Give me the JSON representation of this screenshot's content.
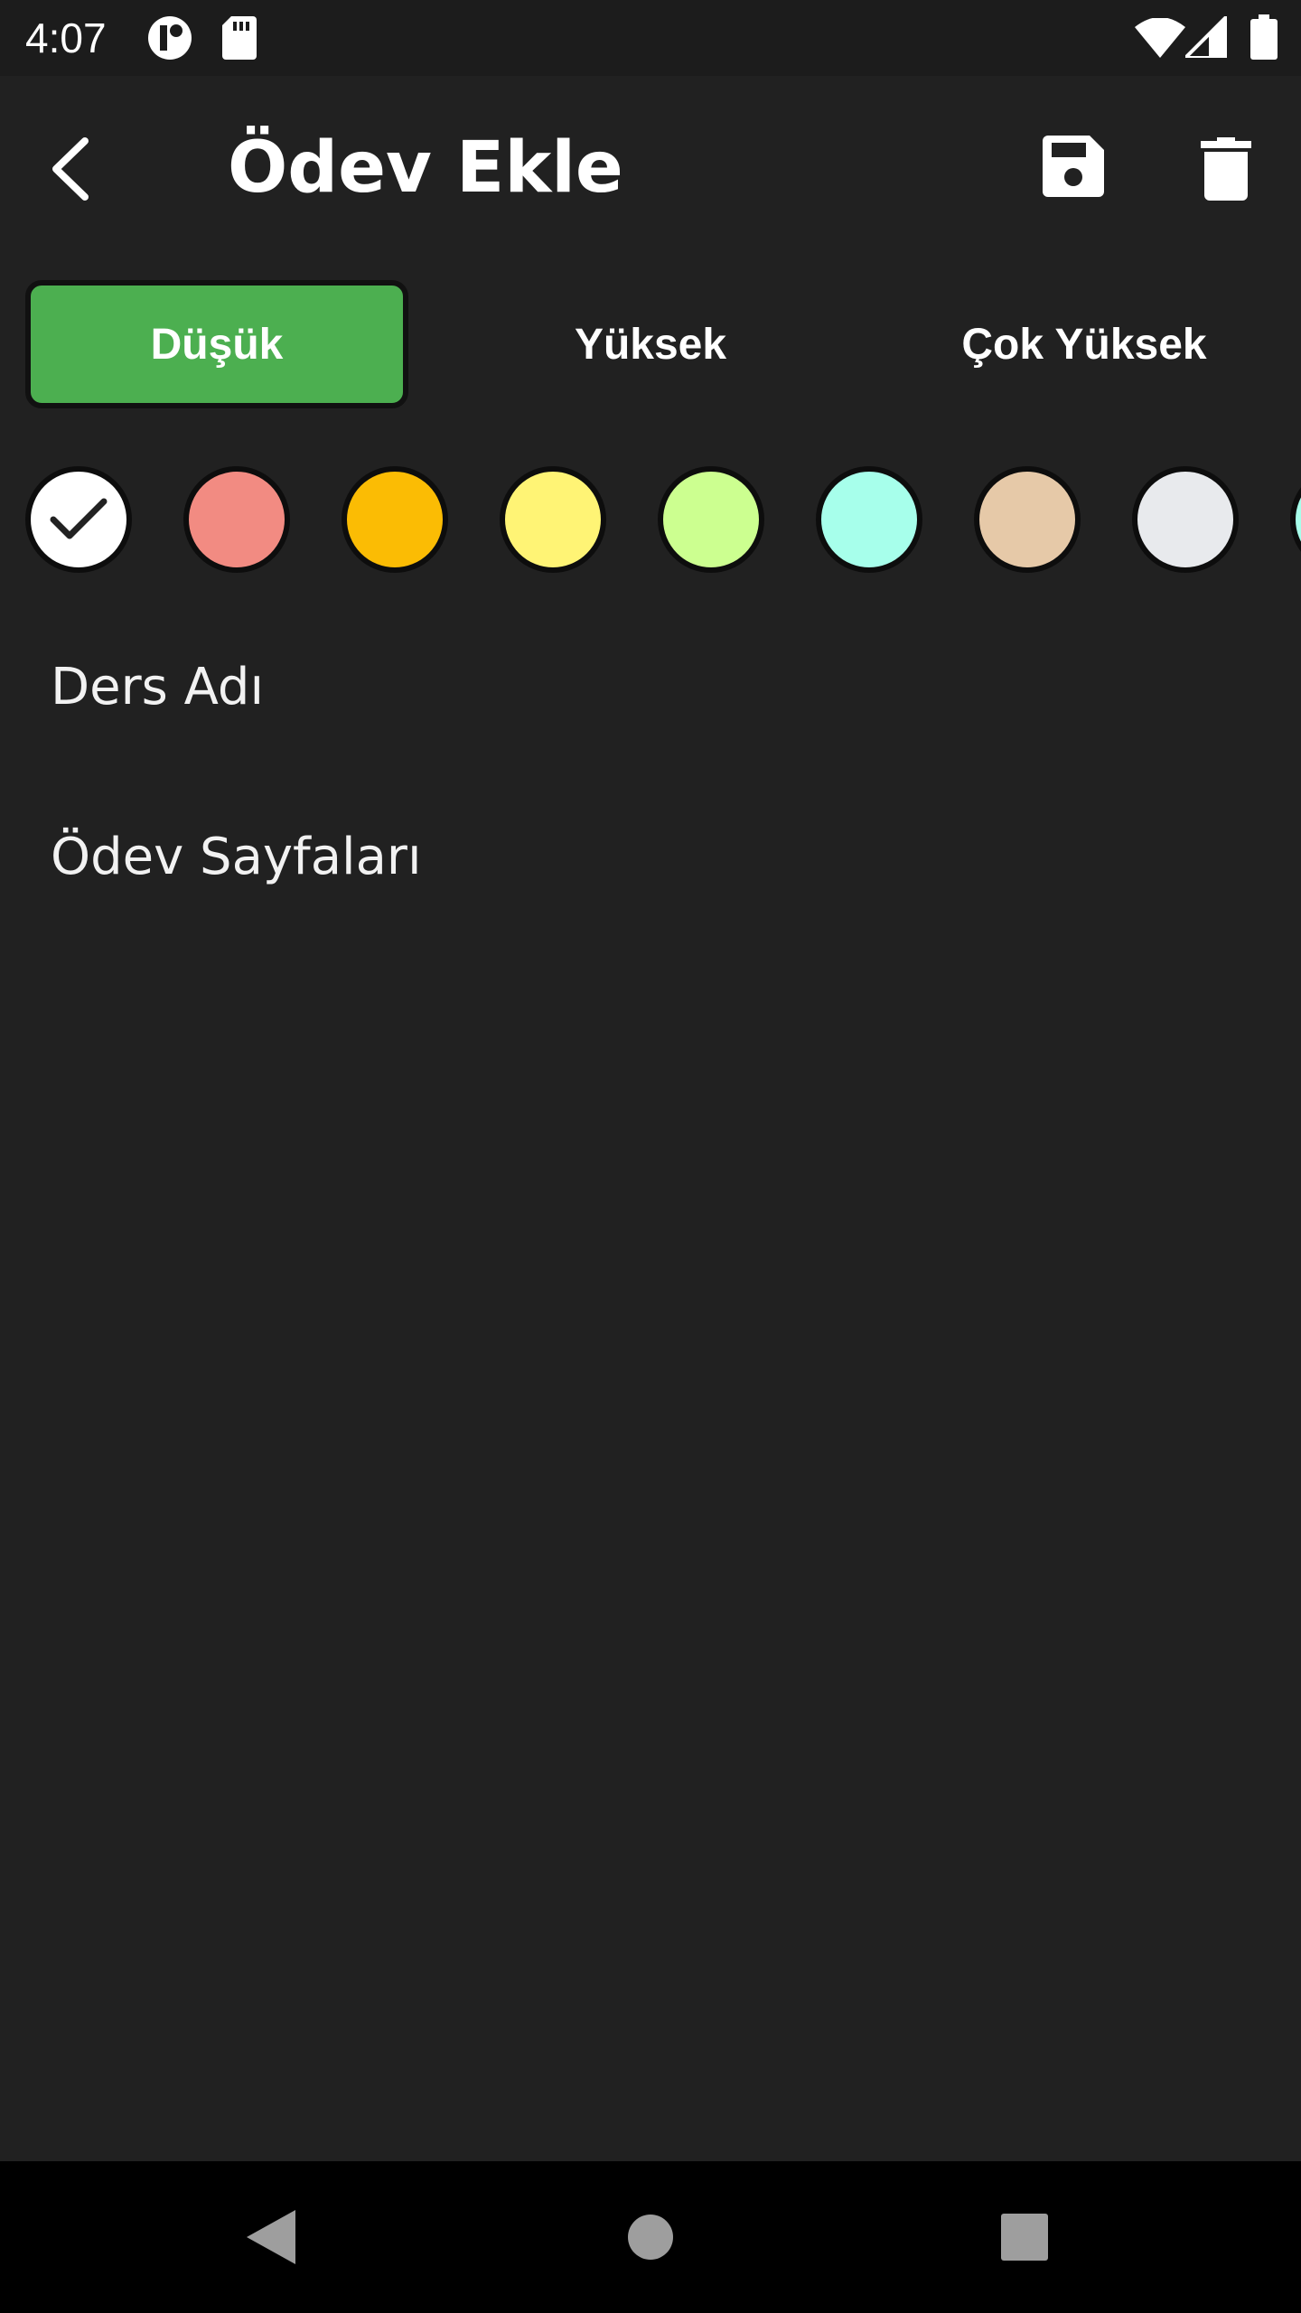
{
  "status_bar": {
    "time": "4:07",
    "icons": [
      "app-notification-icon",
      "sd-card-icon",
      "wifi-icon",
      "cellular-signal-icon",
      "battery-icon"
    ]
  },
  "toolbar": {
    "title": "Ödev Ekle",
    "back_icon": "back-arrow-icon",
    "save_icon": "save-icon",
    "delete_icon": "trash-icon"
  },
  "priority": {
    "options": [
      "Düşük",
      "Yüksek",
      "Çok Yüksek"
    ],
    "selected": "Düşük",
    "active_color": "#4caf50"
  },
  "colors": {
    "swatches": [
      "#ffffff",
      "#f28b82",
      "#fbbc04",
      "#fff475",
      "#ccff90",
      "#a7ffeb",
      "#e6c9a8",
      "#e8eaed",
      "#a7ffeb"
    ],
    "selected_index": 0
  },
  "fields": {
    "course_name_placeholder": "Ders Adı",
    "pages_placeholder": "Ödev Sayfaları"
  },
  "nav_bar": {
    "icons": [
      "nav-back-icon",
      "nav-home-icon",
      "nav-recents-icon"
    ]
  }
}
